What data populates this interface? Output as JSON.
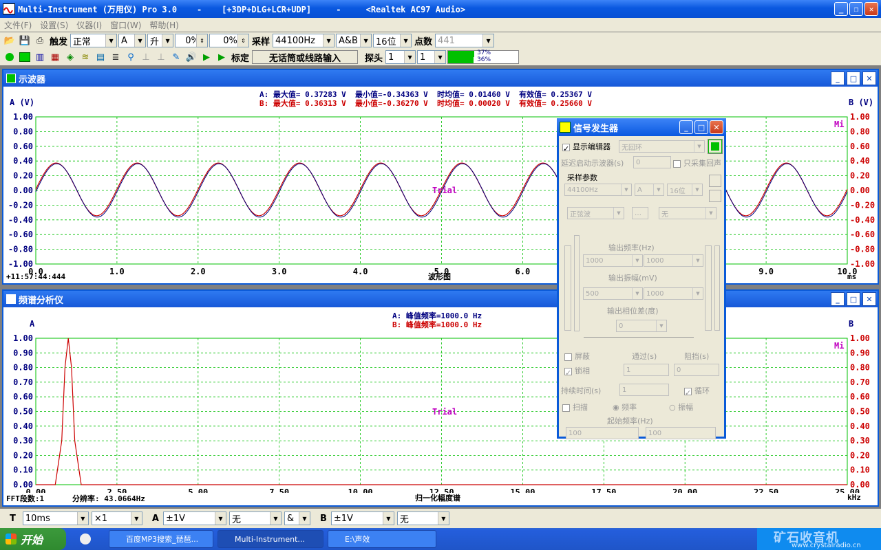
{
  "window": {
    "title": "Multi-Instrument (万用仪) Pro 3.0    -    [+3DP+DLG+LCR+UDP]     -     <Realtek AC97 Audio>"
  },
  "menu": [
    "文件(F)",
    "设置(S)",
    "仪器(I)",
    "窗口(W)",
    "帮助(H)"
  ],
  "toolbar1": {
    "trigger_label": "触发",
    "trigger_mode": "正常",
    "channel": "A",
    "edge": "升",
    "level1": "0%",
    "level2": "0%",
    "sample_label": "采样",
    "sample_rate": "44100Hz",
    "channels": "A&B",
    "bits": "16位",
    "points_label": "点数",
    "points": "441"
  },
  "toolbar2": {
    "calibrate_label": "标定",
    "input_label": "无话筒或线路输入",
    "probe_label": "探头",
    "probe_a": "1",
    "probe_b": "1",
    "level_a": "37%",
    "level_b": "36%"
  },
  "oscilloscope": {
    "title": "示波器",
    "a_unit": "A (V)",
    "b_unit": "B (V)",
    "stats_a": "A: 最大值= 0.37283 V  最小值=-0.34363 V  时均值= 0.01460 V  有效值= 0.25367 V",
    "stats_b": "B: 最大值= 0.36313 V  最小值=-0.36270 V  时均值= 0.00020 V  有效值= 0.25660 V",
    "time": "+11:57:44:444",
    "x_title": "波形图",
    "x_unit": "ms",
    "watermark": "Trial",
    "corner": "Mi",
    "y_ticks": [
      "1.00",
      "0.80",
      "0.60",
      "0.40",
      "0.20",
      "0.00",
      "-0.20",
      "-0.40",
      "-0.60",
      "-0.80",
      "-1.00"
    ],
    "y_ticks_right": [
      "1.00",
      "0.80",
      "0.60",
      "0.40",
      "0.20",
      "0.00",
      "-0.20",
      "-0.40",
      "-0.60",
      "-0.80",
      "-1.00"
    ],
    "x_ticks": [
      "0.0",
      "1.0",
      "2.0",
      "3.0",
      "4.0",
      "5.0",
      "6.0",
      "9.0",
      "10.0"
    ]
  },
  "spectrum": {
    "title": "频谱分析仪",
    "a_unit": "A",
    "b_unit": "B",
    "peak_a": "A: 峰值频率=1000.0 Hz",
    "peak_b": "B: 峰值频率=1000.0 Hz",
    "fft_label": "FFT段数:1",
    "res_label": "分辨率: 43.0664Hz",
    "x_title": "归一化幅度谱",
    "x_unit": "kHz",
    "watermark": "Trial",
    "corner": "Mi",
    "y_ticks": [
      "1.00",
      "0.90",
      "0.80",
      "0.70",
      "0.60",
      "0.50",
      "0.40",
      "0.30",
      "0.20",
      "0.10",
      "0.00"
    ],
    "x_ticks": [
      "0.00",
      "2.50",
      "5.00",
      "7.50",
      "10.00",
      "12.50",
      "15.00",
      "17.50",
      "20.00",
      "22.50",
      "25.00"
    ]
  },
  "chart_data": [
    {
      "type": "line",
      "title": "波形图",
      "xlabel": "ms",
      "ylabel": "A (V)",
      "xlim": [
        0,
        10
      ],
      "ylim": [
        -1,
        1
      ],
      "grid": true,
      "series": [
        {
          "name": "A",
          "frequency_hz": 1000,
          "max": 0.37283,
          "min": -0.34363,
          "mean": 0.0146,
          "rms": 0.25367,
          "color": "#cc0000"
        },
        {
          "name": "B",
          "frequency_hz": 1000,
          "max": 0.36313,
          "min": -0.3627,
          "mean": 0.0002,
          "rms": 0.2566,
          "color": "#000080"
        }
      ]
    },
    {
      "type": "line",
      "title": "归一化幅度谱",
      "xlabel": "kHz",
      "ylim": [
        0,
        1
      ],
      "xlim": [
        0,
        25
      ],
      "grid": true,
      "series": [
        {
          "name": "A",
          "x": [
            0.0,
            0.6,
            0.8,
            0.9,
            1.0,
            1.1,
            1.2,
            1.4,
            25.0
          ],
          "values": [
            0.0,
            0.0,
            0.3,
            0.8,
            1.0,
            0.8,
            0.3,
            0.0,
            0.0
          ],
          "color": "#cc0000"
        }
      ]
    }
  ],
  "generator": {
    "title": "信号发生器",
    "show_editor": "显示编辑器",
    "loop_mode": "无回环",
    "delay_label": "延迟启动示波器(s)",
    "delay_value": "0",
    "only_capture": "只采集回声",
    "sample_params": "采样参数",
    "rate": "44100Hz",
    "ch": "A",
    "bits": "16位",
    "wave": "正弦波",
    "mod": "无",
    "freq_label": "输出频率(Hz)",
    "freq_a": "1000",
    "freq_b": "1000",
    "amp_label": "输出振幅(mV)",
    "amp_a": "500",
    "amp_b": "1000",
    "phase_label": "输出相位差(度)",
    "phase": "0",
    "mask": "屏蔽",
    "pass_label": "通过(s)",
    "block_label": "阻挡(s)",
    "lock": "锁相",
    "pass_val": "1",
    "block_val": "0",
    "duration_label": "持续时间(s)",
    "duration": "1",
    "loop": "循环",
    "sweep": "扫描",
    "freq_opt": "频率",
    "amp_opt": "振幅",
    "start_freq_label": "起始频率(Hz)",
    "start_a": "100",
    "start_b": "100"
  },
  "bottom": {
    "t_label": "T",
    "timebase": "10ms",
    "mult": "×1",
    "a_label": "A",
    "a_range": "±1V",
    "a_mode": "无",
    "op": "&",
    "b_label": "B",
    "b_range": "±1V",
    "b_mode": "无"
  },
  "taskbar": {
    "start": "开始",
    "tasks": [
      "百度MP3搜索_琵琶...",
      "Multi-Instrument...",
      "E:\\声效"
    ],
    "watermark": "矿石收音机",
    "url": "www.crystalradio.cn"
  }
}
